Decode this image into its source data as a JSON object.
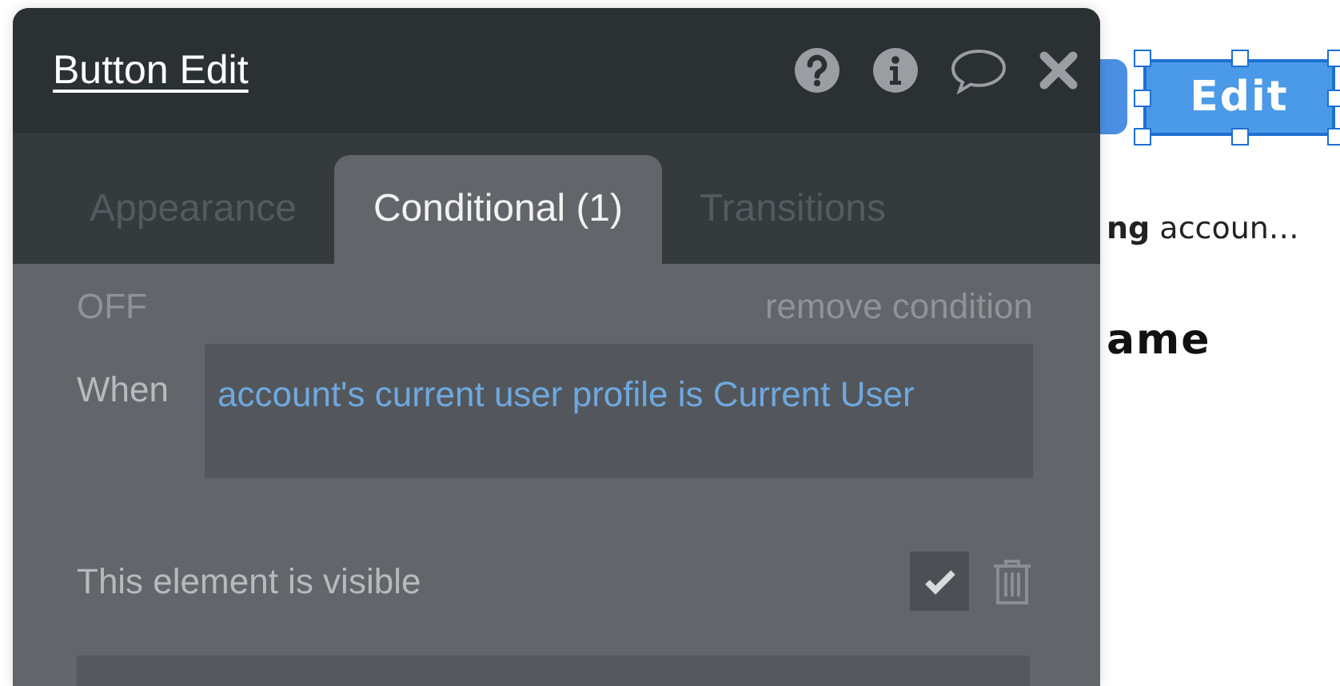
{
  "editor": {
    "title": "Button Edit",
    "tabs": [
      {
        "label": "Appearance",
        "selected": false
      },
      {
        "label": "Conditional (1)",
        "selected": true
      },
      {
        "label": "Transitions",
        "selected": false
      }
    ],
    "condition": {
      "status": "OFF",
      "remove_label": "remove condition",
      "when_label": "When",
      "expression": "account's current user profile is Current User"
    },
    "property": {
      "label": "This element is visible",
      "checked": true
    }
  },
  "canvas": {
    "button_label": "Edit",
    "button_selected": true,
    "text_fragment": "**ng** accoun…",
    "heading_fragment": "ame"
  }
}
